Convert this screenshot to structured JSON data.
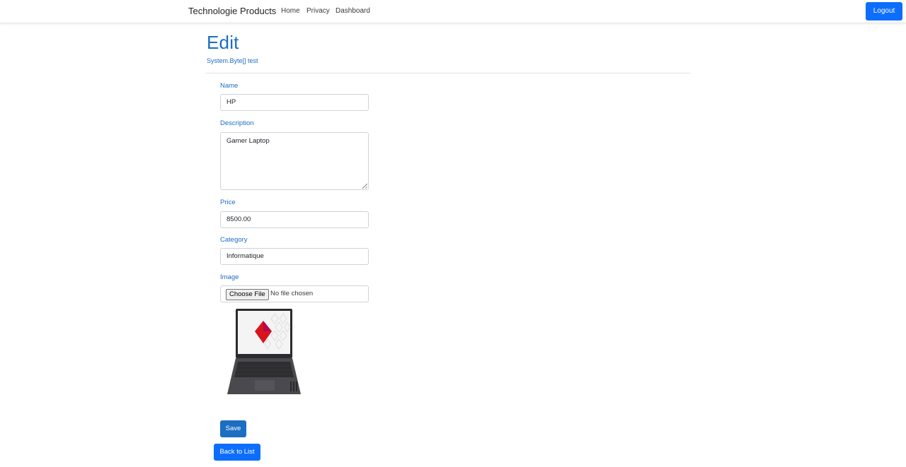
{
  "navbar": {
    "brand": "Technologie Products",
    "links": [
      "Home",
      "Privacy",
      "Dashboard"
    ],
    "logout_label": "Logout"
  },
  "page": {
    "title": "Edit",
    "subtitle": "System.Byte[] test"
  },
  "form": {
    "name": {
      "label": "Name",
      "value": "HP"
    },
    "description": {
      "label": "Description",
      "value": "Gamer Laptop"
    },
    "price": {
      "label": "Price",
      "value": "8500.00"
    },
    "category": {
      "label": "Category",
      "value": "Informatique"
    },
    "image": {
      "label": "Image",
      "button_label": "Choose File",
      "status": "No file chosen"
    },
    "save_label": "Save"
  },
  "back_label": "Back to List",
  "colors": {
    "accent": "#1b6ec2",
    "primary_button": "#0d6efd"
  }
}
